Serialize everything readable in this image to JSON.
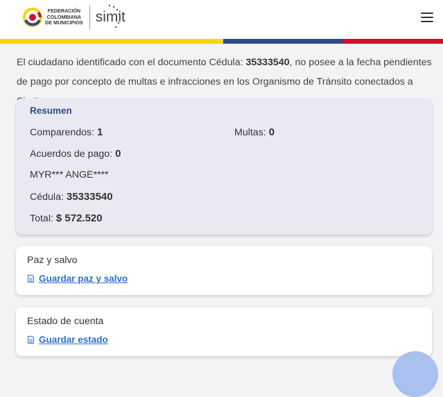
{
  "header": {
    "logo_line1": "Federación",
    "logo_line2": "Colombiana",
    "logo_line3": "de Municipios",
    "brand": "simit",
    "menu_icon": "hamburger-menu-icon"
  },
  "colors": {
    "yellow": "#f7d40e",
    "blue": "#2e4a8f",
    "red": "#d4112a",
    "link": "#2e6fd1"
  },
  "intro": {
    "part1": "El ciudadano identificado con el documento Cédula: ",
    "doc_number": "35333540",
    "part2": ", no posee a la fecha pendientes de pago por concepto de multas e infracciones en los Organismo de Tránsito conectados a Simit."
  },
  "summary": {
    "title": "Resumen",
    "comparendos_label": "Comparendos:",
    "comparendos_value": "1",
    "multas_label": "Multas:",
    "multas_value": "0",
    "acuerdos_label": "Acuerdos de pago:",
    "acuerdos_value": "0",
    "name": "MYR*** ANGE****",
    "cedula_label": "Cédula:",
    "cedula_value": "35333540",
    "total_label": "Total:",
    "total_value": "$ 572.520"
  },
  "paz_y_salvo": {
    "title": "Paz y salvo",
    "link": "Guardar paz y salvo",
    "icon": "document-icon"
  },
  "estado_cuenta": {
    "title": "Estado de cuenta",
    "link": "Guardar estado",
    "icon": "document-icon"
  }
}
